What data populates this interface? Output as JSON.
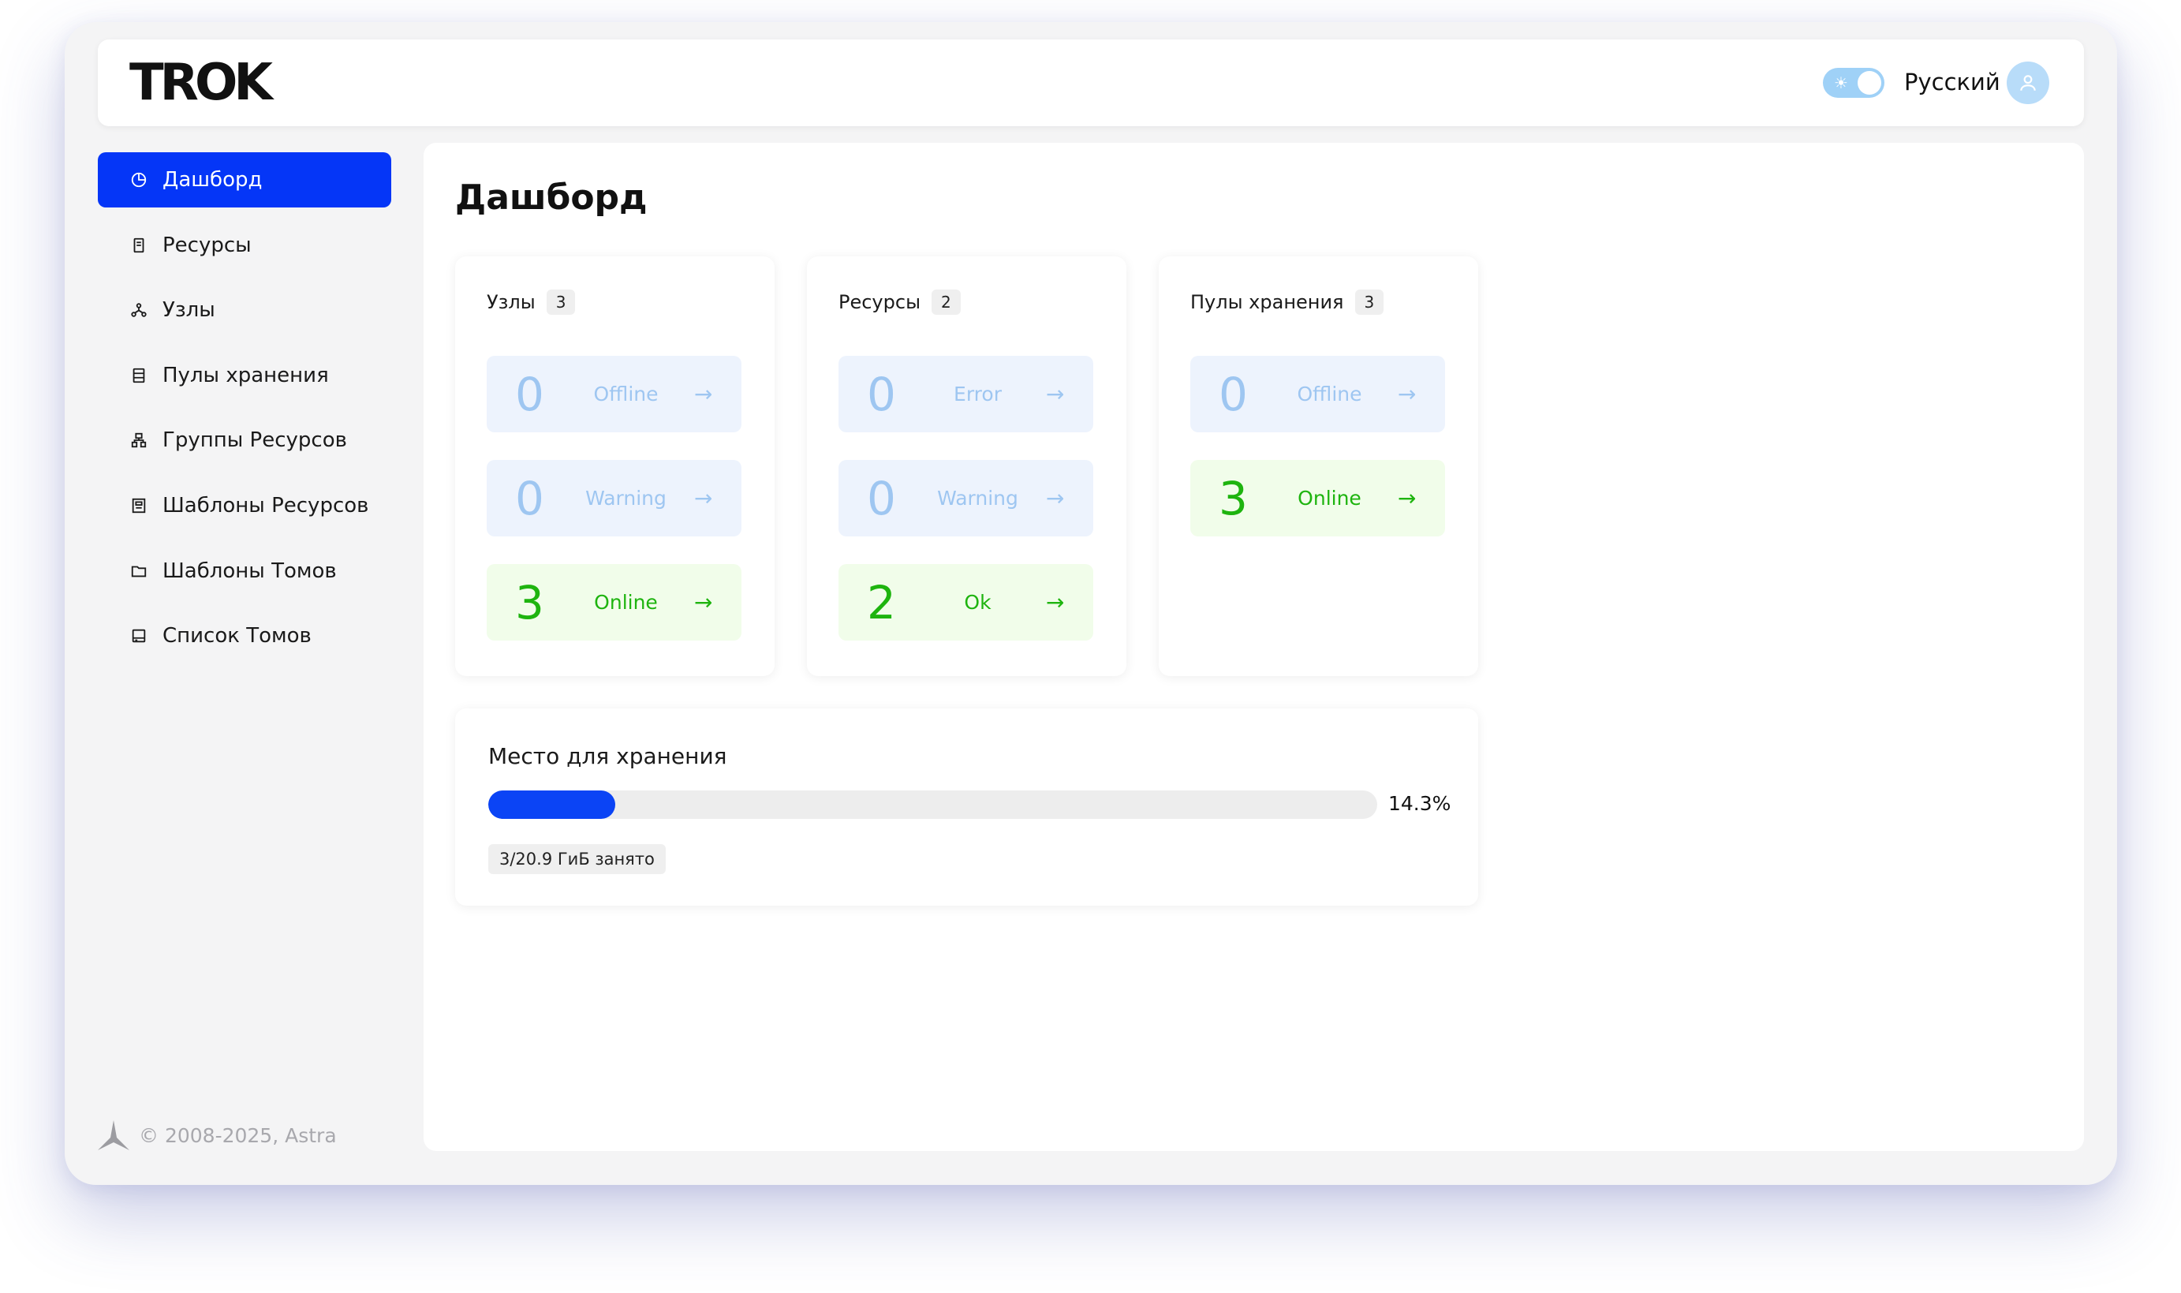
{
  "header": {
    "logo": "TROK",
    "language": "Русский"
  },
  "sidebar": {
    "items": [
      {
        "label": "Дашборд",
        "icon": "pie-chart-icon",
        "active": true
      },
      {
        "label": "Ресурсы",
        "icon": "server-icon",
        "active": false
      },
      {
        "label": "Узлы",
        "icon": "nodes-icon",
        "active": false
      },
      {
        "label": "Пулы хранения",
        "icon": "storage-pool-icon",
        "active": false
      },
      {
        "label": "Группы Ресурсов",
        "icon": "resource-groups-icon",
        "active": false
      },
      {
        "label": "Шаблоны Ресурсов",
        "icon": "resource-template-icon",
        "active": false
      },
      {
        "label": "Шаблоны Томов",
        "icon": "folder-icon",
        "active": false
      },
      {
        "label": "Список Томов",
        "icon": "disk-icon",
        "active": false
      }
    ],
    "footer": "© 2008-2025, Astra"
  },
  "main": {
    "title": "Дашборд",
    "cards": [
      {
        "title": "Узлы",
        "count": "3",
        "stats": [
          {
            "value": "0",
            "label": "Offline",
            "state": "neutral"
          },
          {
            "value": "0",
            "label": "Warning",
            "state": "neutral"
          },
          {
            "value": "3",
            "label": "Online",
            "state": "good"
          }
        ]
      },
      {
        "title": "Ресурсы",
        "count": "2",
        "stats": [
          {
            "value": "0",
            "label": "Error",
            "state": "neutral"
          },
          {
            "value": "0",
            "label": "Warning",
            "state": "neutral"
          },
          {
            "value": "2",
            "label": "Ok",
            "state": "good"
          }
        ]
      },
      {
        "title": "Пулы хранения",
        "count": "3",
        "stats": [
          {
            "value": "0",
            "label": "Offline",
            "state": "neutral"
          },
          {
            "value": "3",
            "label": "Online",
            "state": "good"
          }
        ]
      }
    ],
    "storage": {
      "title": "Место для хранения",
      "percent_label": "14.3%",
      "fraction": 0.143,
      "used_label": "3/20.9 ГиБ занято"
    }
  },
  "colors": {
    "accent": "#0536f7",
    "progress": "#0b44f5",
    "neutral_bg": "#edf3fd",
    "neutral_text": "#9ec6f1",
    "good_bg": "#f1fdea",
    "good_text": "#1eb40f"
  }
}
